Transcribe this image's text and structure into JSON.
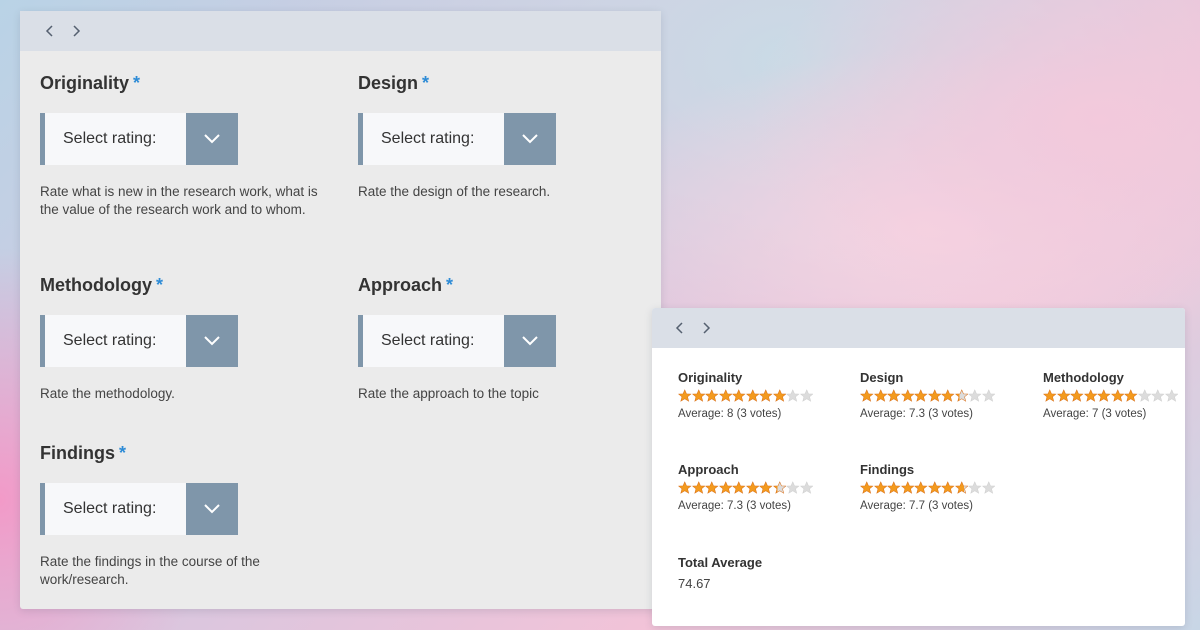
{
  "form": {
    "fields": [
      {
        "label": "Originality",
        "required_mark": "*",
        "select_placeholder": "Select rating:",
        "help": "Rate what is new in the research work, what is the value of the research work and to whom."
      },
      {
        "label": "Design",
        "required_mark": "*",
        "select_placeholder": "Select rating:",
        "help": "Rate the design of the research."
      },
      {
        "label": "Methodology",
        "required_mark": "*",
        "select_placeholder": "Select rating:",
        "help": "Rate the methodology."
      },
      {
        "label": "Approach",
        "required_mark": "*",
        "select_placeholder": "Select rating:",
        "help": "Rate the approach to the topic"
      },
      {
        "label": "Findings",
        "required_mark": "*",
        "select_placeholder": "Select rating:",
        "help": "Rate the findings in the course of the work/research."
      }
    ]
  },
  "results": {
    "items": [
      {
        "title": "Originality",
        "filled_stars": 8,
        "total_stars": 10,
        "average_text": "Average: 8 (3 votes)"
      },
      {
        "title": "Design",
        "filled_stars": 7.3,
        "total_stars": 10,
        "average_text": "Average: 7.3 (3 votes)"
      },
      {
        "title": "Methodology",
        "filled_stars": 7,
        "total_stars": 10,
        "average_text": "Average: 7 (3 votes)"
      },
      {
        "title": "Approach",
        "filled_stars": 7.3,
        "total_stars": 10,
        "average_text": "Average: 7.3 (3 votes)"
      },
      {
        "title": "Findings",
        "filled_stars": 7.7,
        "total_stars": 10,
        "average_text": "Average: 7.7 (3 votes)"
      }
    ],
    "total_label": "Total Average",
    "total_value": "74.67"
  },
  "colors": {
    "accent": "#7f96aa",
    "required": "#2d8bd6",
    "star_filled": "#f39a1e",
    "star_empty": "#dcdcdc"
  },
  "icons": {
    "nav_prev": "chevron-left-icon",
    "nav_next": "chevron-right-icon",
    "select_toggle": "chevron-down-icon",
    "rating_star": "star-icon"
  }
}
